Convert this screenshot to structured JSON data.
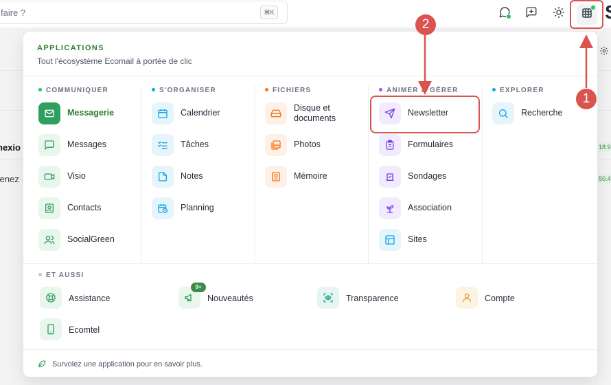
{
  "topbar": {
    "search_placeholder": "faire ?",
    "search_shortcut": "⌘K",
    "icons": [
      "chat-icon",
      "chat-plus-icon",
      "sun-icon",
      "apps-grid-icon"
    ],
    "avatar_fragment": "S"
  },
  "background": {
    "row1_text": "nexio",
    "row2_text": "tenez",
    "row1_badge": "18.9",
    "row2_badge": "50.4"
  },
  "panel": {
    "title": "APPLICATIONS",
    "subtitle": "Tout l'écosystème Ecomail à portée de clic",
    "columns": [
      {
        "heading": "COMMUNIQUER",
        "dot_color": "#22c55e",
        "items": [
          {
            "label": "Messagerie",
            "icon": "mail-icon",
            "active": true
          },
          {
            "label": "Messages",
            "icon": "message-icon"
          },
          {
            "label": "Visio",
            "icon": "video-icon"
          },
          {
            "label": "Contacts",
            "icon": "contacts-icon"
          },
          {
            "label": "SocialGreen",
            "icon": "users-icon"
          }
        ]
      },
      {
        "heading": "S'ORGANISER",
        "dot_color": "#0ea5e9",
        "items": [
          {
            "label": "Calendrier",
            "icon": "calendar-icon"
          },
          {
            "label": "Tâches",
            "icon": "tasks-icon"
          },
          {
            "label": "Notes",
            "icon": "note-icon"
          },
          {
            "label": "Planning",
            "icon": "calendar-clock-icon"
          }
        ]
      },
      {
        "heading": "FICHIERS",
        "dot_color": "#f97316",
        "items": [
          {
            "label": "Disque et documents",
            "icon": "drive-icon"
          },
          {
            "label": "Photos",
            "icon": "photos-icon"
          },
          {
            "label": "Mémoire",
            "icon": "memory-icon"
          }
        ]
      },
      {
        "heading": "ANIMER & GÉRER",
        "dot_color": "#8b5cf6",
        "items": [
          {
            "label": "Newsletter",
            "icon": "send-icon"
          },
          {
            "label": "Formulaires",
            "icon": "clipboard-icon"
          },
          {
            "label": "Sondages",
            "icon": "poll-icon"
          },
          {
            "label": "Association",
            "icon": "sprout-icon"
          },
          {
            "label": "Sites",
            "icon": "layout-icon"
          }
        ]
      },
      {
        "heading": "EXPLORER",
        "dot_color": "#0ea5e9",
        "items": [
          {
            "label": "Recherche",
            "icon": "search-icon"
          }
        ]
      }
    ],
    "extra": {
      "heading": "ET AUSSI",
      "items": [
        {
          "label": "Assistance",
          "icon": "lifebuoy-icon"
        },
        {
          "label": "Nouveautés",
          "icon": "megaphone-icon",
          "badge": "9+"
        },
        {
          "label": "Transparence",
          "icon": "eye-scan-icon"
        },
        {
          "label": "Compte",
          "icon": "user-icon"
        },
        {
          "label": "Ecomtel",
          "icon": "phone-icon"
        }
      ]
    },
    "footer": "Survolez une application pour en savoir plus."
  },
  "annotations": {
    "marker_1": "1",
    "marker_2": "2",
    "color": "#d9534f"
  }
}
